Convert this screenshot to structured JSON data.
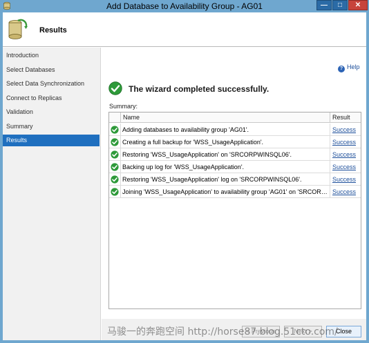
{
  "window": {
    "title": "Add Database to Availability Group - AG01"
  },
  "header": {
    "title": "Results"
  },
  "nav": {
    "items": [
      {
        "label": "Introduction",
        "active": false
      },
      {
        "label": "Select Databases",
        "active": false
      },
      {
        "label": "Select Data Synchronization",
        "active": false
      },
      {
        "label": "Connect to Replicas",
        "active": false
      },
      {
        "label": "Validation",
        "active": false
      },
      {
        "label": "Summary",
        "active": false
      },
      {
        "label": "Results",
        "active": true
      }
    ]
  },
  "content": {
    "help": "Help",
    "success_message": "The wizard completed successfully.",
    "summary_label": "Summary:",
    "columns": {
      "name": "Name",
      "result": "Result"
    },
    "rows": [
      {
        "name": "Adding databases to availability group 'AG01'.",
        "result": "Success"
      },
      {
        "name": "Creating a full backup for 'WSS_UsageApplication'.",
        "result": "Success"
      },
      {
        "name": "Restoring 'WSS_UsageApplication' on 'SRCORPWINSQL06'.",
        "result": "Success"
      },
      {
        "name": "Backing up log for 'WSS_UsageApplication'.",
        "result": "Success"
      },
      {
        "name": "Restoring 'WSS_UsageApplication' log on 'SRCORPWINSQL06'.",
        "result": "Success"
      },
      {
        "name": "Joining 'WSS_UsageApplication' to availability group 'AG01' on 'SRCORPWI...",
        "result": "Success"
      }
    ]
  },
  "buttons": {
    "previous": "< Previous",
    "next": "Next >",
    "close": "Close"
  },
  "watermark": "马骏一的奔跑空间 http://horse87.blog.51cto.com/",
  "colors": {
    "titlebar": "#6fa7cf",
    "nav_active": "#1f6fbf",
    "success_green": "#2e9a3a",
    "link": "#1c4e9a"
  }
}
